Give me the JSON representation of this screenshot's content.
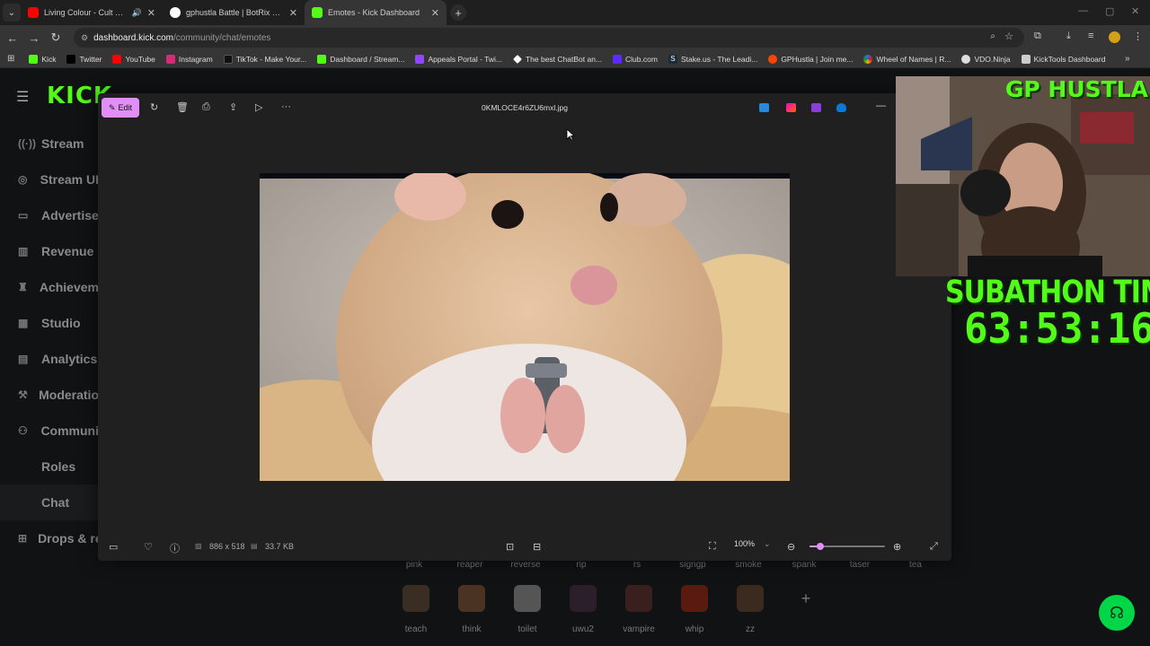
{
  "browser": {
    "tabs": [
      {
        "title": "Living Colour - Cult Of Perso",
        "icon": "youtube-icon",
        "color": "#ff0000",
        "audio": true
      },
      {
        "title": "gphustla Battle | BotRix — Clou",
        "icon": "botrix-icon",
        "color": "#ffffff",
        "audio": false
      },
      {
        "title": "Emotes - Kick Dashboard",
        "icon": "kick-icon",
        "color": "#53fc18",
        "audio": false
      }
    ],
    "url_host": "dashboard.kick.com",
    "url_path": "/community/chat/emotes",
    "bookmarks": [
      {
        "label": "Kick",
        "color": "#53fc18"
      },
      {
        "label": "Twitter",
        "color": "#000000"
      },
      {
        "label": "YouTube",
        "color": "#ff0000"
      },
      {
        "label": "Instagram",
        "color": "#d62976"
      },
      {
        "label": "TikTok - Make Your...",
        "color": "#111111"
      },
      {
        "label": "Dashboard / Stream...",
        "color": "#53fc18"
      },
      {
        "label": "Appeals Portal - Twi...",
        "color": "#9146ff"
      },
      {
        "label": "The best ChatBot an...",
        "color": "#ffffff"
      },
      {
        "label": "Club.com",
        "color": "#5b2bff"
      },
      {
        "label": "Stake.us - The Leadi...",
        "color": "#1a2c38"
      },
      {
        "label": "GPHustla | Join me...",
        "color": "#ff4500"
      },
      {
        "label": "Wheel of Names | R...",
        "color": "#3369e8"
      },
      {
        "label": "VDO.Ninja",
        "color": "#dddddd"
      },
      {
        "label": "KickTools Dashboard",
        "color": "#cccccc"
      }
    ]
  },
  "sidebar": {
    "logo": "KICK",
    "items": [
      {
        "label": "Stream",
        "icon": "broadcast-icon"
      },
      {
        "label": "Stream UI",
        "icon": "layout-icon"
      },
      {
        "label": "Advertise",
        "icon": "ad-icon"
      },
      {
        "label": "Revenue",
        "icon": "chart-icon"
      },
      {
        "label": "Achievem",
        "icon": "trophy-icon"
      },
      {
        "label": "Studio",
        "icon": "film-icon"
      },
      {
        "label": "Analytics",
        "icon": "analytics-icon"
      },
      {
        "label": "Moderatio",
        "icon": "hammer-icon"
      },
      {
        "label": "Communi",
        "icon": "people-icon"
      }
    ],
    "subitems": [
      "Roles",
      "Chat"
    ],
    "drops": "Drops & re"
  },
  "emotes": {
    "top_labels": [
      "pink",
      "reaper",
      "reverse",
      "rip",
      "rs",
      "signgp",
      "smoke",
      "spank",
      "taser",
      "tea"
    ],
    "row": [
      "teach",
      "think",
      "toilet",
      "uwu2",
      "vampire",
      "whip",
      "zz"
    ]
  },
  "viewer": {
    "edit_label": "Edit",
    "filename": "0KMLOCE4r6ZU6mxl.jpg",
    "dimensions": "886 x 518",
    "filesize": "33.7 KB",
    "zoom": "100%",
    "zoom_level": 0.14
  },
  "overlay": {
    "streamer": "GP HUSTLA",
    "timer_title": "SUBATHON TIMER",
    "timer_value": "63:53:16"
  }
}
